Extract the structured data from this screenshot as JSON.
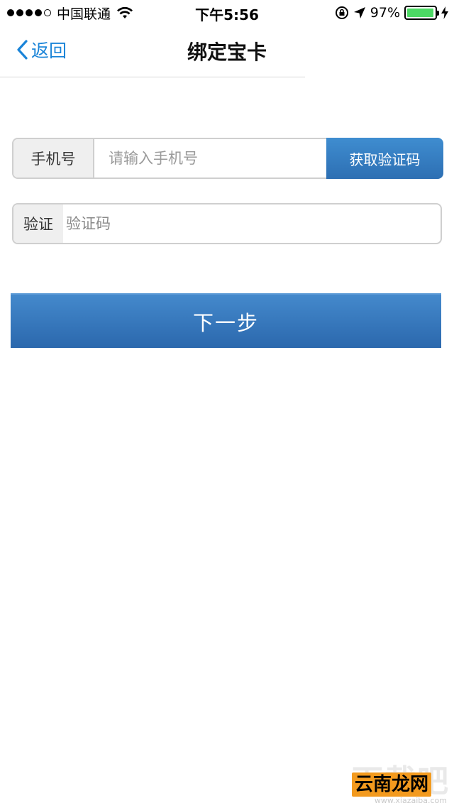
{
  "status_bar": {
    "carrier": "中国联通",
    "time": "下午5:56",
    "battery_percent": "97%",
    "battery_level": 0.97,
    "battery_color": "#4cd964",
    "signal_bars_filled": 4,
    "signal_bars_total": 5
  },
  "nav": {
    "back_label": "返回",
    "title": "绑定宝卡",
    "accent_color": "#1a84d8"
  },
  "phone": {
    "label": "手机号",
    "placeholder": "请输入手机号",
    "value": "",
    "get_code_label": "获取验证码"
  },
  "code": {
    "label": "验证",
    "placeholder": "验证码",
    "value": ""
  },
  "next_button": {
    "label": "下一步",
    "color": "#2f72b6"
  },
  "watermark": {
    "top_text": "下载吧",
    "logo_text": "云南龙网",
    "url_text": "www.xiazaiba.com"
  }
}
